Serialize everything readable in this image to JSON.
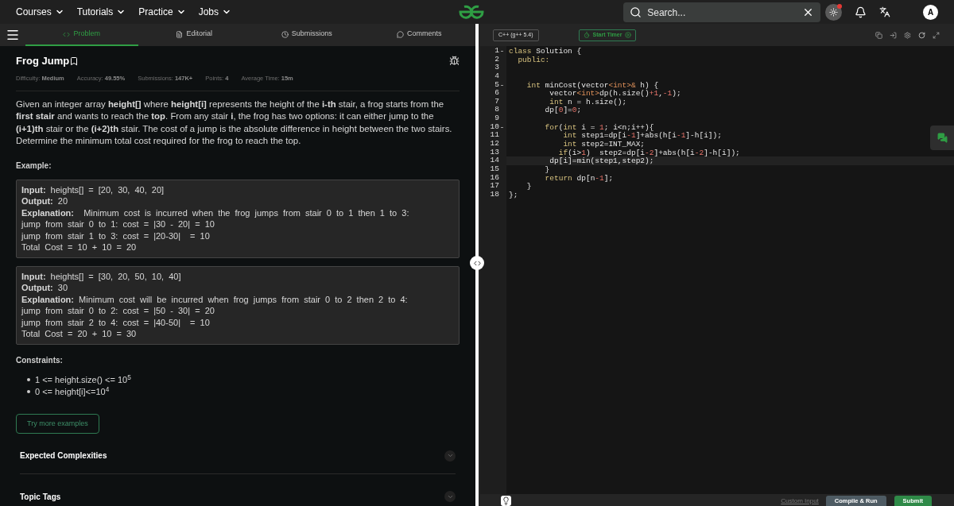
{
  "top_nav": {
    "menus": [
      {
        "label": "Courses"
      },
      {
        "label": "Tutorials"
      },
      {
        "label": "Practice"
      },
      {
        "label": "Jobs"
      }
    ],
    "search": {
      "placeholder": "Search..."
    },
    "avatar": "A",
    "theme_notification": true
  },
  "problem_tabs": [
    {
      "label": "Problem",
      "selected": true
    },
    {
      "label": "Editorial",
      "selected": false
    },
    {
      "label": "Submissions",
      "selected": false
    },
    {
      "label": "Comments",
      "selected": false
    }
  ],
  "problem": {
    "title": "Frog Jump",
    "meta": [
      {
        "label": "Difficulty:",
        "value": "Medium"
      },
      {
        "label": "Accuracy:",
        "value": "49.55%"
      },
      {
        "label": "Submissions:",
        "value": "147K+"
      },
      {
        "label": "Points:",
        "value": "4"
      },
      {
        "label": "Average Time:",
        "value": "15m"
      }
    ],
    "description": "Given an integer array **height[]** where **height[i]** represents the height of the **i-th** stair, a frog starts from the **first stair** and wants to reach the **top**. From any stair **i**, the frog has two options: it can either jump to the **(i+1)th** stair or the **(i+2)th** stair. The cost of a jump is the absolute difference in height between the two stairs. Determine the minimum total cost required for the frog to reach the top.",
    "example_heading": "Example:",
    "examples": [
      [
        "**Input:** heights[] = [20, 30, 40, 20]",
        "**Output:** 20",
        "**Explanation:**  Minimum cost is incurred when the frog jumps from stair 0 to 1 then 1 to 3:",
        "jump from stair 0 to 1: cost = |30 - 20| = 10",
        "jump from stair 1 to 3: cost = |20-30|  = 10",
        "Total Cost = 10 + 10 = 20"
      ],
      [
        "**Input:** heights[] = [30, 20, 50, 10, 40]",
        "**Output:** 30",
        "**Explanation:** Minimum cost will be incurred when frog jumps from stair 0 to 2 then 2 to 4:",
        "jump from stair 0 to 2: cost = |50 - 30| = 20",
        "jump from stair 2 to 4: cost = |40-50|  = 10",
        "Total Cost = 20 + 10 = 30"
      ]
    ],
    "constraints_heading": "Constraints:",
    "constraints": [
      "1 <= height.size() <= 10$^{5}$",
      "0 <= height[i]<=10$^{4}$"
    ],
    "try_button": "Try more examples",
    "sections": [
      {
        "title": "Expected Complexities",
        "expanded": false
      },
      {
        "title": "Topic Tags",
        "expanded": false
      }
    ]
  },
  "editor": {
    "language": "C++ (g++ 5.4)",
    "timer_button": "Start Timer",
    "lines": [
      {
        "number": "1",
        "foldable": true,
        "current": false,
        "tokens": [
          {
            "kind": "kw",
            "text": "class"
          },
          {
            "kind": "plain",
            "text": " Solution {"
          }
        ]
      },
      {
        "number": "2",
        "foldable": false,
        "current": false,
        "tokens": [
          {
            "kind": "kw",
            "text": "  public:"
          }
        ]
      },
      {
        "number": "3",
        "foldable": false,
        "current": false
      },
      {
        "number": "4",
        "foldable": false,
        "current": false
      },
      {
        "number": "5",
        "foldable": true,
        "current": false,
        "tokens": [
          {
            "kind": "kw",
            "text": "    int"
          },
          {
            "kind": "plain",
            "text": " minCost(vector"
          },
          {
            "kind": "op",
            "text": "<int>&"
          },
          {
            "kind": "plain",
            "text": " h) {"
          }
        ]
      },
      {
        "number": "6",
        "foldable": false,
        "current": false,
        "tokens": [
          {
            "kind": "plain",
            "text": "         vector"
          },
          {
            "kind": "op",
            "text": "<int>"
          },
          {
            "kind": "plain",
            "text": "dp(h.size()"
          },
          {
            "kind": "num",
            "text": "+1"
          },
          {
            "kind": "plain",
            "text": ","
          },
          {
            "kind": "num",
            "text": "-1"
          },
          {
            "kind": "plain",
            "text": ");"
          }
        ]
      },
      {
        "number": "7",
        "foldable": false,
        "current": false,
        "tokens": [
          {
            "kind": "kw",
            "text": "         int"
          },
          {
            "kind": "plain",
            "text": " n = h.size();"
          }
        ]
      },
      {
        "number": "8",
        "foldable": false,
        "current": false,
        "tokens": [
          {
            "kind": "plain",
            "text": "        dp["
          },
          {
            "kind": "num",
            "text": "0"
          },
          {
            "kind": "plain",
            "text": "]="
          },
          {
            "kind": "num",
            "text": "0"
          },
          {
            "kind": "plain",
            "text": ";"
          }
        ]
      },
      {
        "number": "9",
        "foldable": false,
        "current": false
      },
      {
        "number": "10",
        "foldable": true,
        "current": false,
        "tokens": [
          {
            "kind": "kw",
            "text": "        for"
          },
          {
            "kind": "plain",
            "text": "("
          },
          {
            "kind": "kw",
            "text": "int"
          },
          {
            "kind": "plain",
            "text": " i = "
          },
          {
            "kind": "num",
            "text": "1"
          },
          {
            "kind": "plain",
            "text": "; i<n;i++){"
          }
        ]
      },
      {
        "number": "11",
        "foldable": false,
        "current": false,
        "tokens": [
          {
            "kind": "kw",
            "text": "            int"
          },
          {
            "kind": "plain",
            "text": " step1=dp[i"
          },
          {
            "kind": "num",
            "text": "-1"
          },
          {
            "kind": "plain",
            "text": "]+abs(h[i"
          },
          {
            "kind": "num",
            "text": "-1"
          },
          {
            "kind": "plain",
            "text": "]-h[i]);"
          }
        ]
      },
      {
        "number": "12",
        "foldable": false,
        "current": false,
        "tokens": [
          {
            "kind": "kw",
            "text": "            int"
          },
          {
            "kind": "plain",
            "text": " step2=INT_MAX;"
          }
        ]
      },
      {
        "number": "13",
        "foldable": false,
        "current": false,
        "tokens": [
          {
            "kind": "kw",
            "text": "           if"
          },
          {
            "kind": "plain",
            "text": "(i>"
          },
          {
            "kind": "num",
            "text": "1"
          },
          {
            "kind": "plain",
            "text": ")  step2=dp[i"
          },
          {
            "kind": "num",
            "text": "-2"
          },
          {
            "kind": "plain",
            "text": "]+abs(h[i"
          },
          {
            "kind": "num",
            "text": "-2"
          },
          {
            "kind": "plain",
            "text": "]-h[i]);"
          }
        ]
      },
      {
        "number": "14",
        "foldable": false,
        "current": true,
        "tokens": [
          {
            "kind": "plain",
            "text": "         dp[i]=min(step1,step2);"
          }
        ]
      },
      {
        "number": "15",
        "foldable": false,
        "current": false,
        "tokens": [
          {
            "kind": "plain",
            "text": "        }"
          }
        ]
      },
      {
        "number": "16",
        "foldable": false,
        "current": false,
        "tokens": [
          {
            "kind": "kw",
            "text": "        return"
          },
          {
            "kind": "plain",
            "text": " dp[n"
          },
          {
            "kind": "num",
            "text": "-1"
          },
          {
            "kind": "plain",
            "text": "];"
          }
        ]
      },
      {
        "number": "17",
        "foldable": false,
        "current": false,
        "tokens": [
          {
            "kind": "plain",
            "text": "    }"
          }
        ]
      },
      {
        "number": "18",
        "foldable": false,
        "current": false,
        "tokens": [
          {
            "kind": "plain",
            "text": "};"
          }
        ]
      }
    ]
  },
  "bottom_bar": {
    "custom_input": "Custom Input",
    "compile_button": "Compile & Run",
    "submit_button": "Submit"
  }
}
